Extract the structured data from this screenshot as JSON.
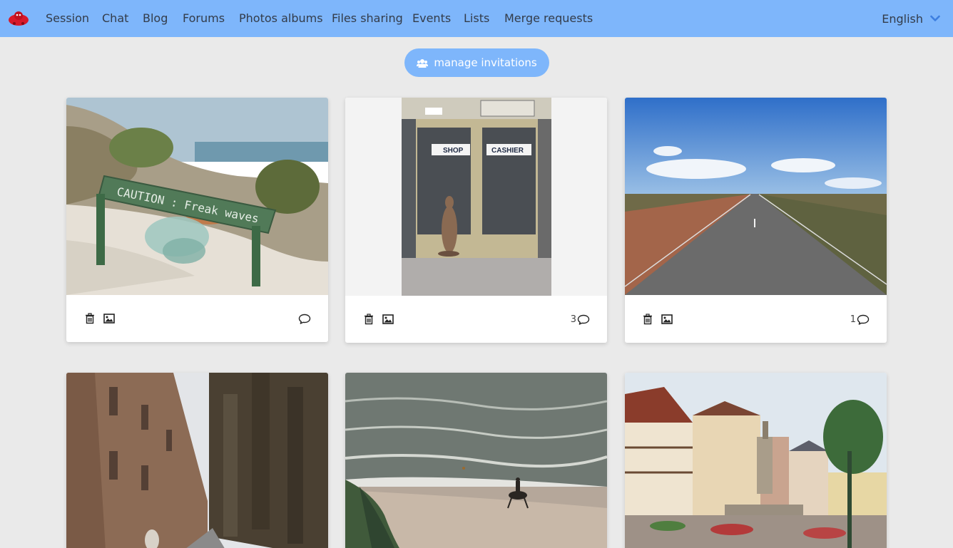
{
  "nav": {
    "items": [
      "Session",
      "Chat",
      "Blog",
      "Forums",
      "Photos albums",
      "Files sharing",
      "Events",
      "Lists",
      "Merge requests"
    ],
    "language": "English"
  },
  "actions": {
    "manage_label": "manage invitations"
  },
  "cards": [
    {
      "photo": "caution-freak-waves-sign",
      "comment_count": "",
      "caption_1": "CAUTION : Freak  waves"
    },
    {
      "photo": "kangaroo-shop-door",
      "comment_count": "3",
      "caption_1": "SHOP",
      "caption_2": "CASHIER"
    },
    {
      "photo": "outback-road",
      "comment_count": "1"
    },
    {
      "photo": "cathedral-street",
      "comment_count": ""
    },
    {
      "photo": "beach-horse-rider",
      "comment_count": ""
    },
    {
      "photo": "town-square-statue",
      "comment_count": ""
    }
  ],
  "colors": {
    "accent": "#7eb6fb",
    "background": "#eaeaea"
  }
}
